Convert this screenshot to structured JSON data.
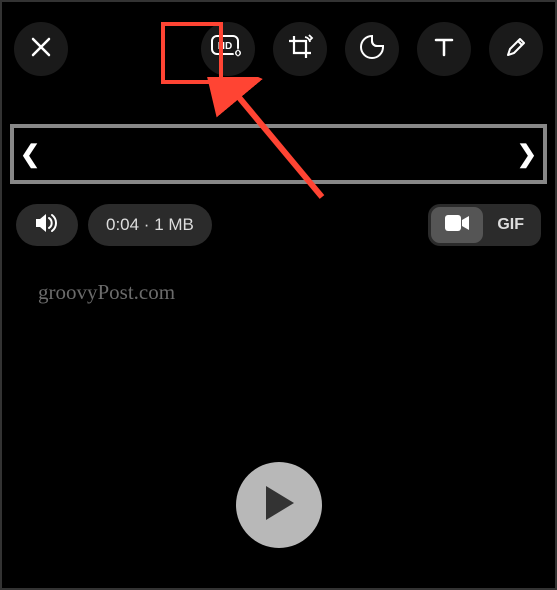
{
  "toolbar": {
    "close": "close",
    "hd": "hd-quality",
    "crop": "crop-rotate",
    "sticker": "sticker",
    "text": "text",
    "draw": "draw"
  },
  "trimmer": {
    "left": "❮",
    "right": "❯"
  },
  "info": {
    "sound": "sound-on",
    "duration_size": "0:04 · 1 MB",
    "video_label": "video",
    "gif_label": "GIF"
  },
  "watermark": "groovyPost.com",
  "play": "play",
  "highlight_color": "#ff4433"
}
